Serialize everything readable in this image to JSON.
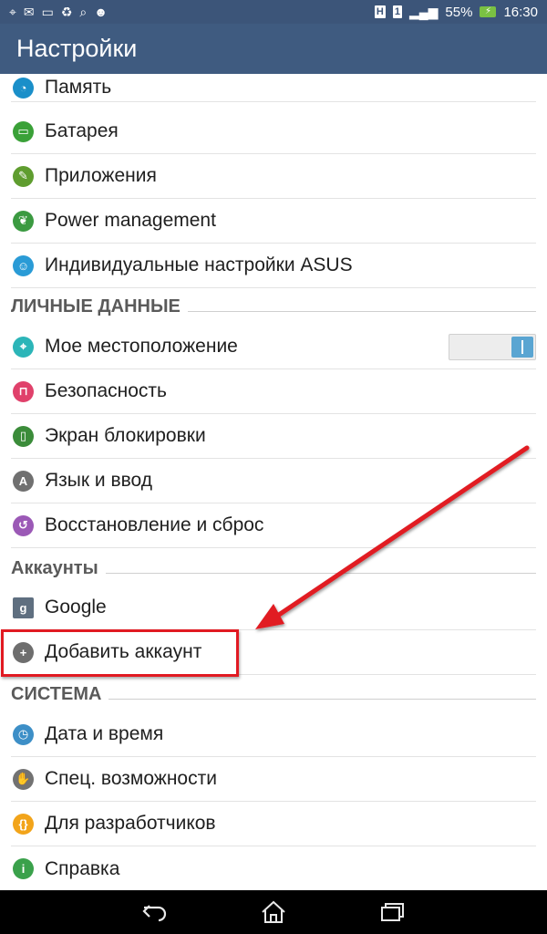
{
  "status_bar": {
    "notif_icons": [
      "gps-icon",
      "message-icon",
      "mail-icon",
      "recycle-icon",
      "search-icon",
      "android-icon"
    ],
    "network_h": "H",
    "sim_slot": "1",
    "battery_percent": "55%",
    "time": "16:30"
  },
  "action_bar": {
    "title": "Настройки"
  },
  "sections": [
    {
      "id": "device",
      "items": [
        {
          "label": "Память",
          "icon": "storage-icon",
          "color": "#1a8fc9"
        },
        {
          "label": "Батарея",
          "icon": "battery-icon",
          "color": "#3aa138"
        },
        {
          "label": "Приложения",
          "icon": "apps-icon",
          "color": "#5f9d2f"
        },
        {
          "label": "Power management",
          "icon": "power-management-icon",
          "color": "#3b9a41"
        },
        {
          "label": "Индивидуальные настройки ASUS",
          "icon": "asus-settings-icon",
          "color": "#2a9bd6"
        }
      ]
    },
    {
      "id": "personal",
      "title": "ЛИЧНЫЕ ДАННЫЕ",
      "items": [
        {
          "label": "Мое местоположение",
          "icon": "location-icon",
          "color": "#2cb5b8",
          "toggle": true
        },
        {
          "label": "Безопасность",
          "icon": "lock-icon",
          "color": "#e0416b"
        },
        {
          "label": "Экран блокировки",
          "icon": "lock-screen-icon",
          "color": "#3b8c3a"
        },
        {
          "label": "Язык и ввод",
          "icon": "language-icon",
          "color": "#707070"
        },
        {
          "label": "Восстановление и сброс",
          "icon": "backup-icon",
          "color": "#9b59b6"
        }
      ]
    },
    {
      "id": "accounts",
      "title": "Аккаунты",
      "items": [
        {
          "label": "Google",
          "icon": "google-icon",
          "color": "#5f6f80"
        },
        {
          "label": "Добавить аккаунт",
          "icon": "add-icon",
          "color": "#6e6e6e"
        }
      ]
    },
    {
      "id": "system",
      "title": "СИСТЕМА",
      "items": [
        {
          "label": "Дата и время",
          "icon": "clock-icon",
          "color": "#3d8fc7"
        },
        {
          "label": "Спец. возможности",
          "icon": "accessibility-icon",
          "color": "#727272"
        },
        {
          "label": "Для разработчиков",
          "icon": "developer-icon",
          "color": "#f2a41a"
        },
        {
          "label": "Справка",
          "icon": "help-icon",
          "color": "#3aa14b"
        }
      ]
    }
  ],
  "nav_bar": [
    "back-icon",
    "home-icon",
    "recents-icon"
  ],
  "colors": {
    "status_bar": "#3c5579",
    "action_bar": "#3f5b80",
    "annotation": "#e11a22",
    "toggle_on": "#5aa5d2"
  }
}
